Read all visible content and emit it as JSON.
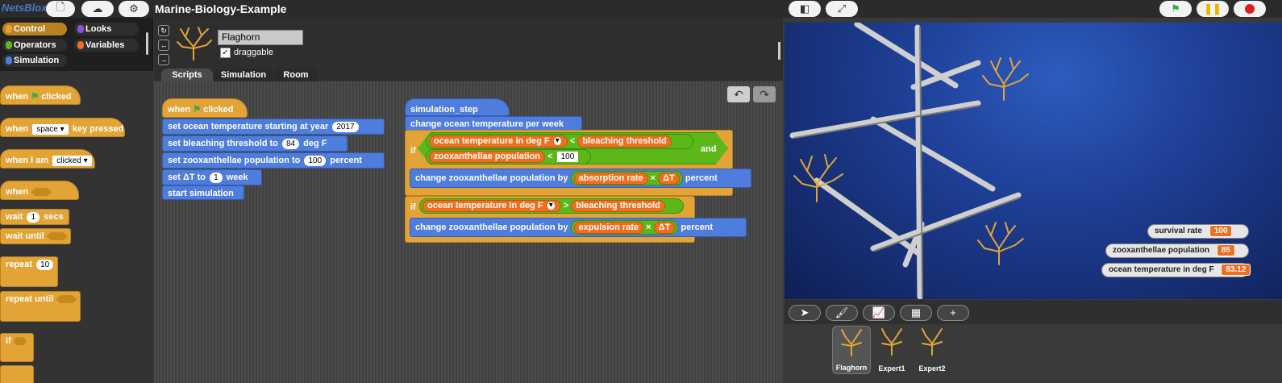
{
  "app": {
    "logo": "NetsBlox",
    "project_title": "Marine-Biology-Example"
  },
  "categories": [
    {
      "label": "Control",
      "color": "#e3a437"
    },
    {
      "label": "Looks",
      "color": "#8a55d7"
    },
    {
      "label": "Operators",
      "color": "#5cb81a"
    },
    {
      "label": "Variables",
      "color": "#ee6f1e"
    },
    {
      "label": "Simulation",
      "color": "#4f7ddd"
    }
  ],
  "palette": {
    "when_flag": "when",
    "when_flag_2": "clicked",
    "when_key": "when",
    "key_slot": "space",
    "key_rest": "key pressed",
    "when_i_am": "when I am",
    "clicked_slot": "clicked",
    "when_cond": "when",
    "wait": "wait",
    "wait_num": "1",
    "wait_secs": "secs",
    "wait_until": "wait until",
    "repeat": "repeat",
    "repeat_num": "10",
    "repeat_until": "repeat until",
    "if": "if"
  },
  "sprite": {
    "name": "Flaghorn",
    "draggable_label": "draggable",
    "draggable_check": "✓"
  },
  "tabs": [
    "Scripts",
    "Simulation",
    "Room"
  ],
  "script1": {
    "hat_when": "when",
    "hat_clicked": "clicked",
    "l1_text": "set ocean temperature starting at year",
    "l1_val": "2017",
    "l2_text": "set bleaching threshold to",
    "l2_val": "84",
    "l2_unit": "deg F",
    "l3_text": "set zooxanthellae population to",
    "l3_val": "100",
    "l3_unit": "percent",
    "l4_text": "set ΔT to",
    "l4_val": "1",
    "l4_unit": "week",
    "l5_text": "start simulation"
  },
  "script2": {
    "hat": "simulation_step",
    "change_temp": "change ocean temperature per week",
    "if1": "if",
    "temp_var": "ocean temperature in deg F",
    "lt": "<",
    "thresh_var": "bleaching threshold",
    "and": "and",
    "zoo_var": "zooxanthellae population",
    "lt2": "<",
    "zoo_val": "100",
    "change1": "change zooxanthellae population by",
    "absorb_var": "absorption rate",
    "times": "×",
    "dt_var": "ΔT",
    "percent1": "percent",
    "if2": "if",
    "temp_var2": "ocean temperature in deg F",
    "gt": ">",
    "thresh_var2": "bleaching threshold",
    "change2": "change zooxanthellae population by",
    "expel_var": "expulsion rate",
    "times2": "×",
    "dt_var2": "ΔT",
    "percent2": "percent"
  },
  "monitors": [
    {
      "label": "survival rate",
      "value": "100"
    },
    {
      "label": "zooxanthellae population",
      "value": "85"
    },
    {
      "label": "ocean temperature in deg F",
      "value": "83.12"
    }
  ],
  "sprites": [
    {
      "name": "Flaghorn"
    },
    {
      "name": "Expert1"
    },
    {
      "name": "Expert2"
    }
  ],
  "colors": {
    "accent_green": "#3aa845",
    "pause_yellow": "#e6b800",
    "stop_red": "#d82020"
  }
}
